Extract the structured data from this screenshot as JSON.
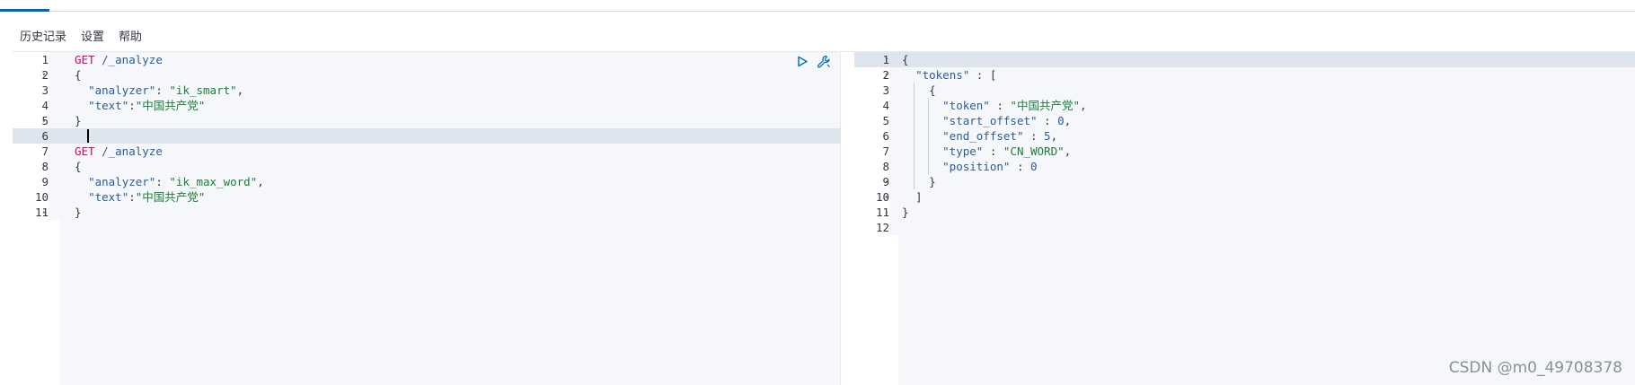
{
  "menu": {
    "history": "历史记录",
    "settings": "设置",
    "help": "帮助"
  },
  "request": {
    "lines": [
      {
        "num": "1",
        "fold": "",
        "segments": [
          {
            "cls": "k-method",
            "t": "GET "
          },
          {
            "cls": "k-path",
            "t": "/_analyze"
          }
        ]
      },
      {
        "num": "2",
        "fold": "▾",
        "segments": [
          {
            "cls": "k-punc",
            "t": "{"
          }
        ]
      },
      {
        "num": "3",
        "fold": "",
        "segments": [
          {
            "cls": "k-punc",
            "t": "  "
          },
          {
            "cls": "k-key",
            "t": "\"analyzer\""
          },
          {
            "cls": "k-punc",
            "t": ": "
          },
          {
            "cls": "k-str",
            "t": "\"ik_smart\""
          },
          {
            "cls": "k-punc",
            "t": ","
          }
        ]
      },
      {
        "num": "4",
        "fold": "",
        "segments": [
          {
            "cls": "k-punc",
            "t": "  "
          },
          {
            "cls": "k-key",
            "t": "\"text\""
          },
          {
            "cls": "k-punc",
            "t": ":"
          },
          {
            "cls": "k-str",
            "t": "\"中国共产党\""
          }
        ]
      },
      {
        "num": "5",
        "fold": "▴",
        "segments": [
          {
            "cls": "k-punc",
            "t": "}"
          }
        ]
      },
      {
        "num": "6",
        "fold": "",
        "segments": []
      },
      {
        "num": "7",
        "fold": "",
        "segments": [
          {
            "cls": "k-method",
            "t": "GET "
          },
          {
            "cls": "k-path",
            "t": "/_analyze"
          }
        ]
      },
      {
        "num": "8",
        "fold": "▾",
        "segments": [
          {
            "cls": "k-punc",
            "t": "{"
          }
        ]
      },
      {
        "num": "9",
        "fold": "",
        "segments": [
          {
            "cls": "k-punc",
            "t": "  "
          },
          {
            "cls": "k-key",
            "t": "\"analyzer\""
          },
          {
            "cls": "k-punc",
            "t": ": "
          },
          {
            "cls": "k-str",
            "t": "\"ik_max_word\""
          },
          {
            "cls": "k-punc",
            "t": ","
          }
        ]
      },
      {
        "num": "10",
        "fold": "",
        "segments": [
          {
            "cls": "k-punc",
            "t": "  "
          },
          {
            "cls": "k-key",
            "t": "\"text\""
          },
          {
            "cls": "k-punc",
            "t": ":"
          },
          {
            "cls": "k-str",
            "t": "\"中国共产党\""
          }
        ]
      },
      {
        "num": "11",
        "fold": "▴",
        "segments": [
          {
            "cls": "k-punc",
            "t": "}"
          }
        ]
      }
    ]
  },
  "response": {
    "lines": [
      {
        "num": "1",
        "fold": "▾",
        "segments": [
          {
            "cls": "k-punc",
            "t": "{"
          }
        ]
      },
      {
        "num": "2",
        "fold": "▾",
        "segments": [
          {
            "cls": "k-punc",
            "t": "  "
          },
          {
            "cls": "k-key",
            "t": "\"tokens\""
          },
          {
            "cls": "k-punc",
            "t": " : ["
          }
        ]
      },
      {
        "num": "3",
        "fold": "▾",
        "segments": [
          {
            "cls": "k-punc",
            "t": "    {"
          }
        ]
      },
      {
        "num": "4",
        "fold": "",
        "segments": [
          {
            "cls": "k-punc",
            "t": "      "
          },
          {
            "cls": "k-key",
            "t": "\"token\""
          },
          {
            "cls": "k-punc",
            "t": " : "
          },
          {
            "cls": "k-str",
            "t": "\"中国共产党\""
          },
          {
            "cls": "k-punc",
            "t": ","
          }
        ]
      },
      {
        "num": "5",
        "fold": "",
        "segments": [
          {
            "cls": "k-punc",
            "t": "      "
          },
          {
            "cls": "k-key",
            "t": "\"start_offset\""
          },
          {
            "cls": "k-punc",
            "t": " : "
          },
          {
            "cls": "k-num",
            "t": "0"
          },
          {
            "cls": "k-punc",
            "t": ","
          }
        ]
      },
      {
        "num": "6",
        "fold": "",
        "segments": [
          {
            "cls": "k-punc",
            "t": "      "
          },
          {
            "cls": "k-key",
            "t": "\"end_offset\""
          },
          {
            "cls": "k-punc",
            "t": " : "
          },
          {
            "cls": "k-num",
            "t": "5"
          },
          {
            "cls": "k-punc",
            "t": ","
          }
        ]
      },
      {
        "num": "7",
        "fold": "",
        "segments": [
          {
            "cls": "k-punc",
            "t": "      "
          },
          {
            "cls": "k-key",
            "t": "\"type\""
          },
          {
            "cls": "k-punc",
            "t": " : "
          },
          {
            "cls": "k-str",
            "t": "\"CN_WORD\""
          },
          {
            "cls": "k-punc",
            "t": ","
          }
        ]
      },
      {
        "num": "8",
        "fold": "",
        "segments": [
          {
            "cls": "k-punc",
            "t": "      "
          },
          {
            "cls": "k-key",
            "t": "\"position\""
          },
          {
            "cls": "k-punc",
            "t": " : "
          },
          {
            "cls": "k-num",
            "t": "0"
          }
        ]
      },
      {
        "num": "9",
        "fold": "▴",
        "segments": [
          {
            "cls": "k-punc",
            "t": "    }"
          }
        ]
      },
      {
        "num": "10",
        "fold": "▴",
        "segments": [
          {
            "cls": "k-punc",
            "t": "  ]"
          }
        ]
      },
      {
        "num": "11",
        "fold": "▴",
        "segments": [
          {
            "cls": "k-punc",
            "t": "}"
          }
        ]
      },
      {
        "num": "12",
        "fold": "",
        "segments": []
      }
    ]
  },
  "actions": {
    "run_icon": "play-icon",
    "settings_icon": "wrench-icon"
  },
  "watermark": "CSDN @m0_49708378",
  "colors": {
    "accent": "#006bb4",
    "method": "#c80a68",
    "key": "#2a5d98",
    "string": "#1a7f37",
    "line_highlight": "#dfe5ef"
  }
}
